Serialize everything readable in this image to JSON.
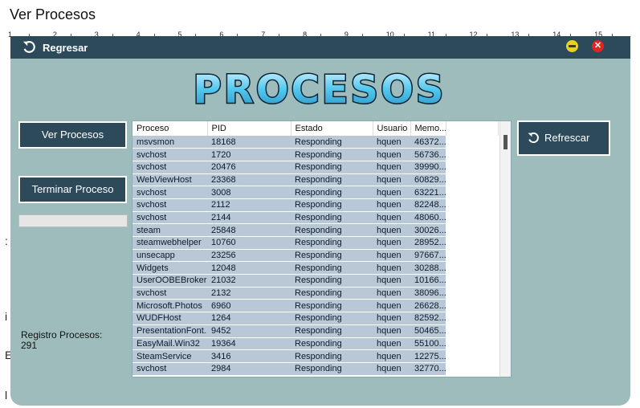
{
  "page": {
    "heading": "Ver Procesos"
  },
  "ruler": {
    "labels": [
      "1",
      "2",
      "3",
      "4",
      "5",
      "6",
      "7",
      "8",
      "9",
      "10",
      "11",
      "12",
      "13",
      "14",
      "15"
    ]
  },
  "side_glyphs": [
    ":",
    "i",
    "E",
    "l"
  ],
  "window": {
    "back_label": "Regresar",
    "logo_text": "PROCESOS",
    "colors": {
      "titlebar": "#2d4a5b",
      "window_bg": "#9ebcbb",
      "row_bg": "#b8c8d6"
    }
  },
  "buttons": {
    "ver": "Ver Procesos",
    "terminar": "Terminar Proceso",
    "refrescar": "Refrescar"
  },
  "progress": {
    "value_percent": 0
  },
  "registro": {
    "label": "Registro Procesos:",
    "count": "291"
  },
  "table": {
    "columns": [
      "Proceso",
      "PID",
      "Estado",
      "Usuario",
      "Memo..."
    ],
    "rows": [
      [
        "msvsmon",
        "18168",
        "Responding",
        "hquen",
        "46372..."
      ],
      [
        "svchost",
        "1720",
        "Responding",
        "hquen",
        "56736..."
      ],
      [
        "svchost",
        "20476",
        "Responding",
        "hquen",
        "39990..."
      ],
      [
        "WebViewHost",
        "23368",
        "Responding",
        "hquen",
        "60829..."
      ],
      [
        "svchost",
        "3008",
        "Responding",
        "hquen",
        "63221..."
      ],
      [
        "svchost",
        "2112",
        "Responding",
        "hquen",
        "82248..."
      ],
      [
        "svchost",
        "2144",
        "Responding",
        "hquen",
        "48060..."
      ],
      [
        "steam",
        "25848",
        "Responding",
        "hquen",
        "30026..."
      ],
      [
        "steamwebhelper",
        "10760",
        "Responding",
        "hquen",
        "28952..."
      ],
      [
        "unsecapp",
        "23256",
        "Responding",
        "hquen",
        "97667..."
      ],
      [
        "Widgets",
        "12048",
        "Responding",
        "hquen",
        "30288..."
      ],
      [
        "UserOOBEBroker",
        "21032",
        "Responding",
        "hquen",
        "10166..."
      ],
      [
        "svchost",
        "2132",
        "Responding",
        "hquen",
        "38096..."
      ],
      [
        "Microsoft.Photos",
        "6960",
        "Responding",
        "hquen",
        "26628..."
      ],
      [
        "WUDFHost",
        "1264",
        "Responding",
        "hquen",
        "82592..."
      ],
      [
        "PresentationFont...",
        "9452",
        "Responding",
        "hquen",
        "50465..."
      ],
      [
        "EasyMail.Win32",
        "19364",
        "Responding",
        "hquen",
        "55100..."
      ],
      [
        "SteamService",
        "3416",
        "Responding",
        "hquen",
        "12275..."
      ],
      [
        "svchost",
        "2984",
        "Responding",
        "hquen",
        "32770..."
      ]
    ]
  }
}
